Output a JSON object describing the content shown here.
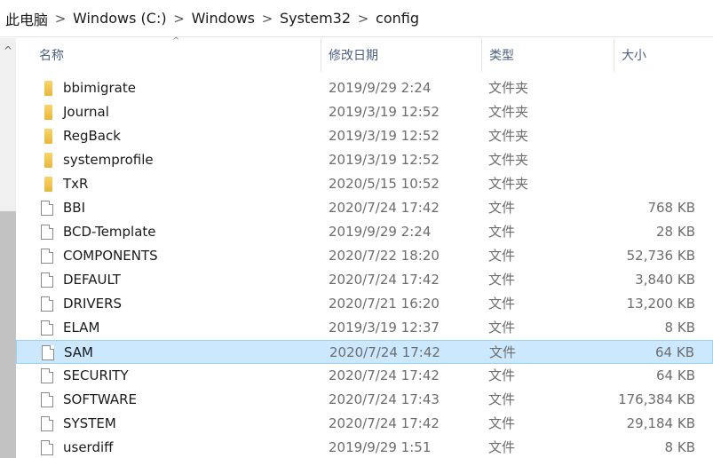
{
  "breadcrumb": {
    "items": [
      "此电脑",
      "Windows (C:)",
      "Windows",
      "System32",
      "config"
    ],
    "separator": ">"
  },
  "columns": {
    "name": "名称",
    "date": "修改日期",
    "type": "类型",
    "size": "大小",
    "sort_indicator": "^"
  },
  "scrollbar": {
    "up_arrow": "^"
  },
  "files": [
    {
      "name": "bbimigrate",
      "date": "2019/9/29 2:24",
      "type": "文件夹",
      "size": "",
      "icon": "folder-icon"
    },
    {
      "name": "Journal",
      "date": "2019/3/19 12:52",
      "type": "文件夹",
      "size": "",
      "icon": "folder-icon"
    },
    {
      "name": "RegBack",
      "date": "2019/3/19 12:52",
      "type": "文件夹",
      "size": "",
      "icon": "folder-icon"
    },
    {
      "name": "systemprofile",
      "date": "2019/3/19 12:52",
      "type": "文件夹",
      "size": "",
      "icon": "folder-icon"
    },
    {
      "name": "TxR",
      "date": "2020/5/15 10:52",
      "type": "文件夹",
      "size": "",
      "icon": "folder-icon"
    },
    {
      "name": "BBI",
      "date": "2020/7/24 17:42",
      "type": "文件",
      "size": "768 KB",
      "icon": "file-icon"
    },
    {
      "name": "BCD-Template",
      "date": "2019/9/29 2:24",
      "type": "文件",
      "size": "28 KB",
      "icon": "file-icon"
    },
    {
      "name": "COMPONENTS",
      "date": "2020/7/22 18:20",
      "type": "文件",
      "size": "52,736 KB",
      "icon": "file-icon"
    },
    {
      "name": "DEFAULT",
      "date": "2020/7/24 17:42",
      "type": "文件",
      "size": "3,840 KB",
      "icon": "file-icon"
    },
    {
      "name": "DRIVERS",
      "date": "2020/7/21 16:20",
      "type": "文件",
      "size": "13,200 KB",
      "icon": "file-icon"
    },
    {
      "name": "ELAM",
      "date": "2019/3/19 12:37",
      "type": "文件",
      "size": "8 KB",
      "icon": "file-icon"
    },
    {
      "name": "SAM",
      "date": "2020/7/24 17:42",
      "type": "文件",
      "size": "64 KB",
      "icon": "file-icon",
      "selected": true
    },
    {
      "name": "SECURITY",
      "date": "2020/7/24 17:42",
      "type": "文件",
      "size": "64 KB",
      "icon": "file-icon"
    },
    {
      "name": "SOFTWARE",
      "date": "2020/7/24 17:43",
      "type": "文件",
      "size": "176,384 KB",
      "icon": "file-icon"
    },
    {
      "name": "SYSTEM",
      "date": "2020/7/24 17:42",
      "type": "文件",
      "size": "29,184 KB",
      "icon": "file-icon"
    },
    {
      "name": "userdiff",
      "date": "2019/9/29 1:51",
      "type": "文件",
      "size": "8 KB",
      "icon": "file-icon"
    }
  ],
  "colors": {
    "selection_bg": "#cce8ff",
    "selection_border": "#99d1ff",
    "header_text": "#4d6082",
    "folder": "#e9b73a"
  }
}
